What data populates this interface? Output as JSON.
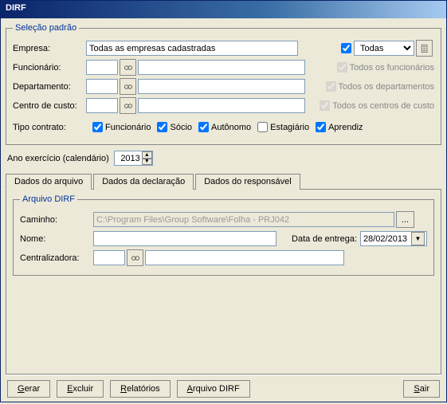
{
  "title": "DIRF",
  "selecao": {
    "legend": "Seleção padrão",
    "empresa_label": "Empresa:",
    "empresa_value": "Todas as empresas cadastradas",
    "todas_check_label": "Todas",
    "funcionario_label": "Funcionário:",
    "todos_func_label": "Todos os funcionários",
    "departamento_label": "Departamento:",
    "todos_dept_label": "Todos os departamentos",
    "centro_label": "Centro de custo:",
    "todos_centro_label": "Todos os centros de custo",
    "tipo_label": "Tipo contrato:",
    "tipo_funcionario": "Funcionário",
    "tipo_socio": "Sócio",
    "tipo_autonomo": "Autônomo",
    "tipo_estagiario": "Estagiário",
    "tipo_aprendiz": "Aprendiz"
  },
  "ano_label": "Ano exercício (calendário)",
  "ano_value": "2013",
  "tabs": {
    "arquivo": "Dados do arquivo",
    "declaracao": "Dados da declaração",
    "responsavel": "Dados do responsável"
  },
  "arquivo": {
    "legend": "Arquivo DIRF",
    "caminho_label": "Caminho:",
    "caminho_value": "C:\\Program Files\\Group Software\\Folha - PRJ042",
    "nome_label": "Nome:",
    "nome_value": "",
    "data_entrega_label": "Data de entrega:",
    "data_entrega_value": "28/02/2013",
    "centralizadora_label": "Centralizadora:",
    "browse_label": "..."
  },
  "buttons": {
    "gerar": "Gerar",
    "excluir": "Excluir",
    "relatorios": "Relatórios",
    "arquivo_dirf": "Arquivo DIRF",
    "sair": "Sair"
  }
}
